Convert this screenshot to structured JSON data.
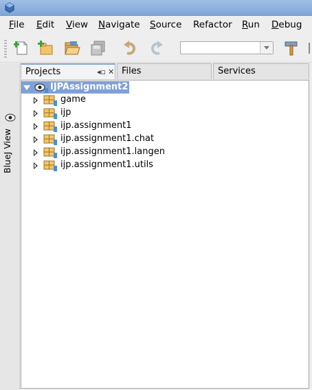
{
  "menubar": {
    "items": [
      {
        "key": "F",
        "rest": "ile"
      },
      {
        "key": "E",
        "rest": "dit"
      },
      {
        "key": "V",
        "rest": "iew"
      },
      {
        "key": "N",
        "rest": "avigate"
      },
      {
        "key": "S",
        "rest": "ource"
      },
      {
        "key": "R",
        "rest": "efactor",
        "pre": "",
        "full": "Refactor"
      },
      {
        "key": "R",
        "rest": "un"
      },
      {
        "key": "D",
        "rest": "ebug"
      }
    ]
  },
  "toolbar": {
    "config_value": "",
    "icons": [
      "new-file-icon",
      "new-project-icon",
      "open-project-icon",
      "save-all-icon",
      "undo-icon",
      "redo-icon",
      "build-hammer-icon"
    ]
  },
  "sidebar": {
    "label": "BlueJ View"
  },
  "tabs": [
    {
      "label": "Projects"
    },
    {
      "label": "Files"
    },
    {
      "label": "Services"
    }
  ],
  "tree": {
    "root": "IJPAssignment2",
    "packages": [
      "game",
      "ijp",
      "ijp.assignment1",
      "ijp.assignment1.chat",
      "ijp.assignment1.langen",
      "ijp.assignment1.utils"
    ]
  }
}
